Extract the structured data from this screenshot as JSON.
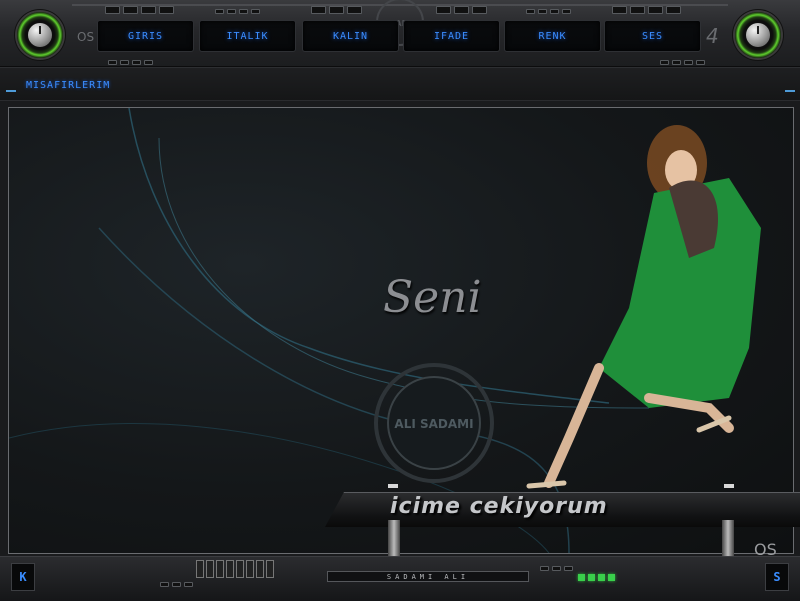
{
  "toolbar": {
    "menu": [
      {
        "label": "GIRIS"
      },
      {
        "label": "ITALIK"
      },
      {
        "label": "KALIN"
      },
      {
        "label": "IFADE"
      },
      {
        "label": "RENK"
      },
      {
        "label": "SES"
      }
    ],
    "left_mark": "OS",
    "right_mark": "4",
    "badge_text": "ALI SADAMI"
  },
  "subbar": {
    "visitors_label": "MISAFIRLERIM"
  },
  "stage": {
    "script_title": "Seni",
    "tagline": "icime cekiyorum",
    "emblem_text": "ALI SADAMI",
    "corner_mark": "OS"
  },
  "bottombar": {
    "left_box": "K",
    "right_box": "S",
    "credit": "SADAMI ALI"
  },
  "colors": {
    "accent_blue": "#3a8dff",
    "knob_green": "#5fd12d",
    "led_green": "#39d04b",
    "frame_gray": "#6a6c70"
  }
}
